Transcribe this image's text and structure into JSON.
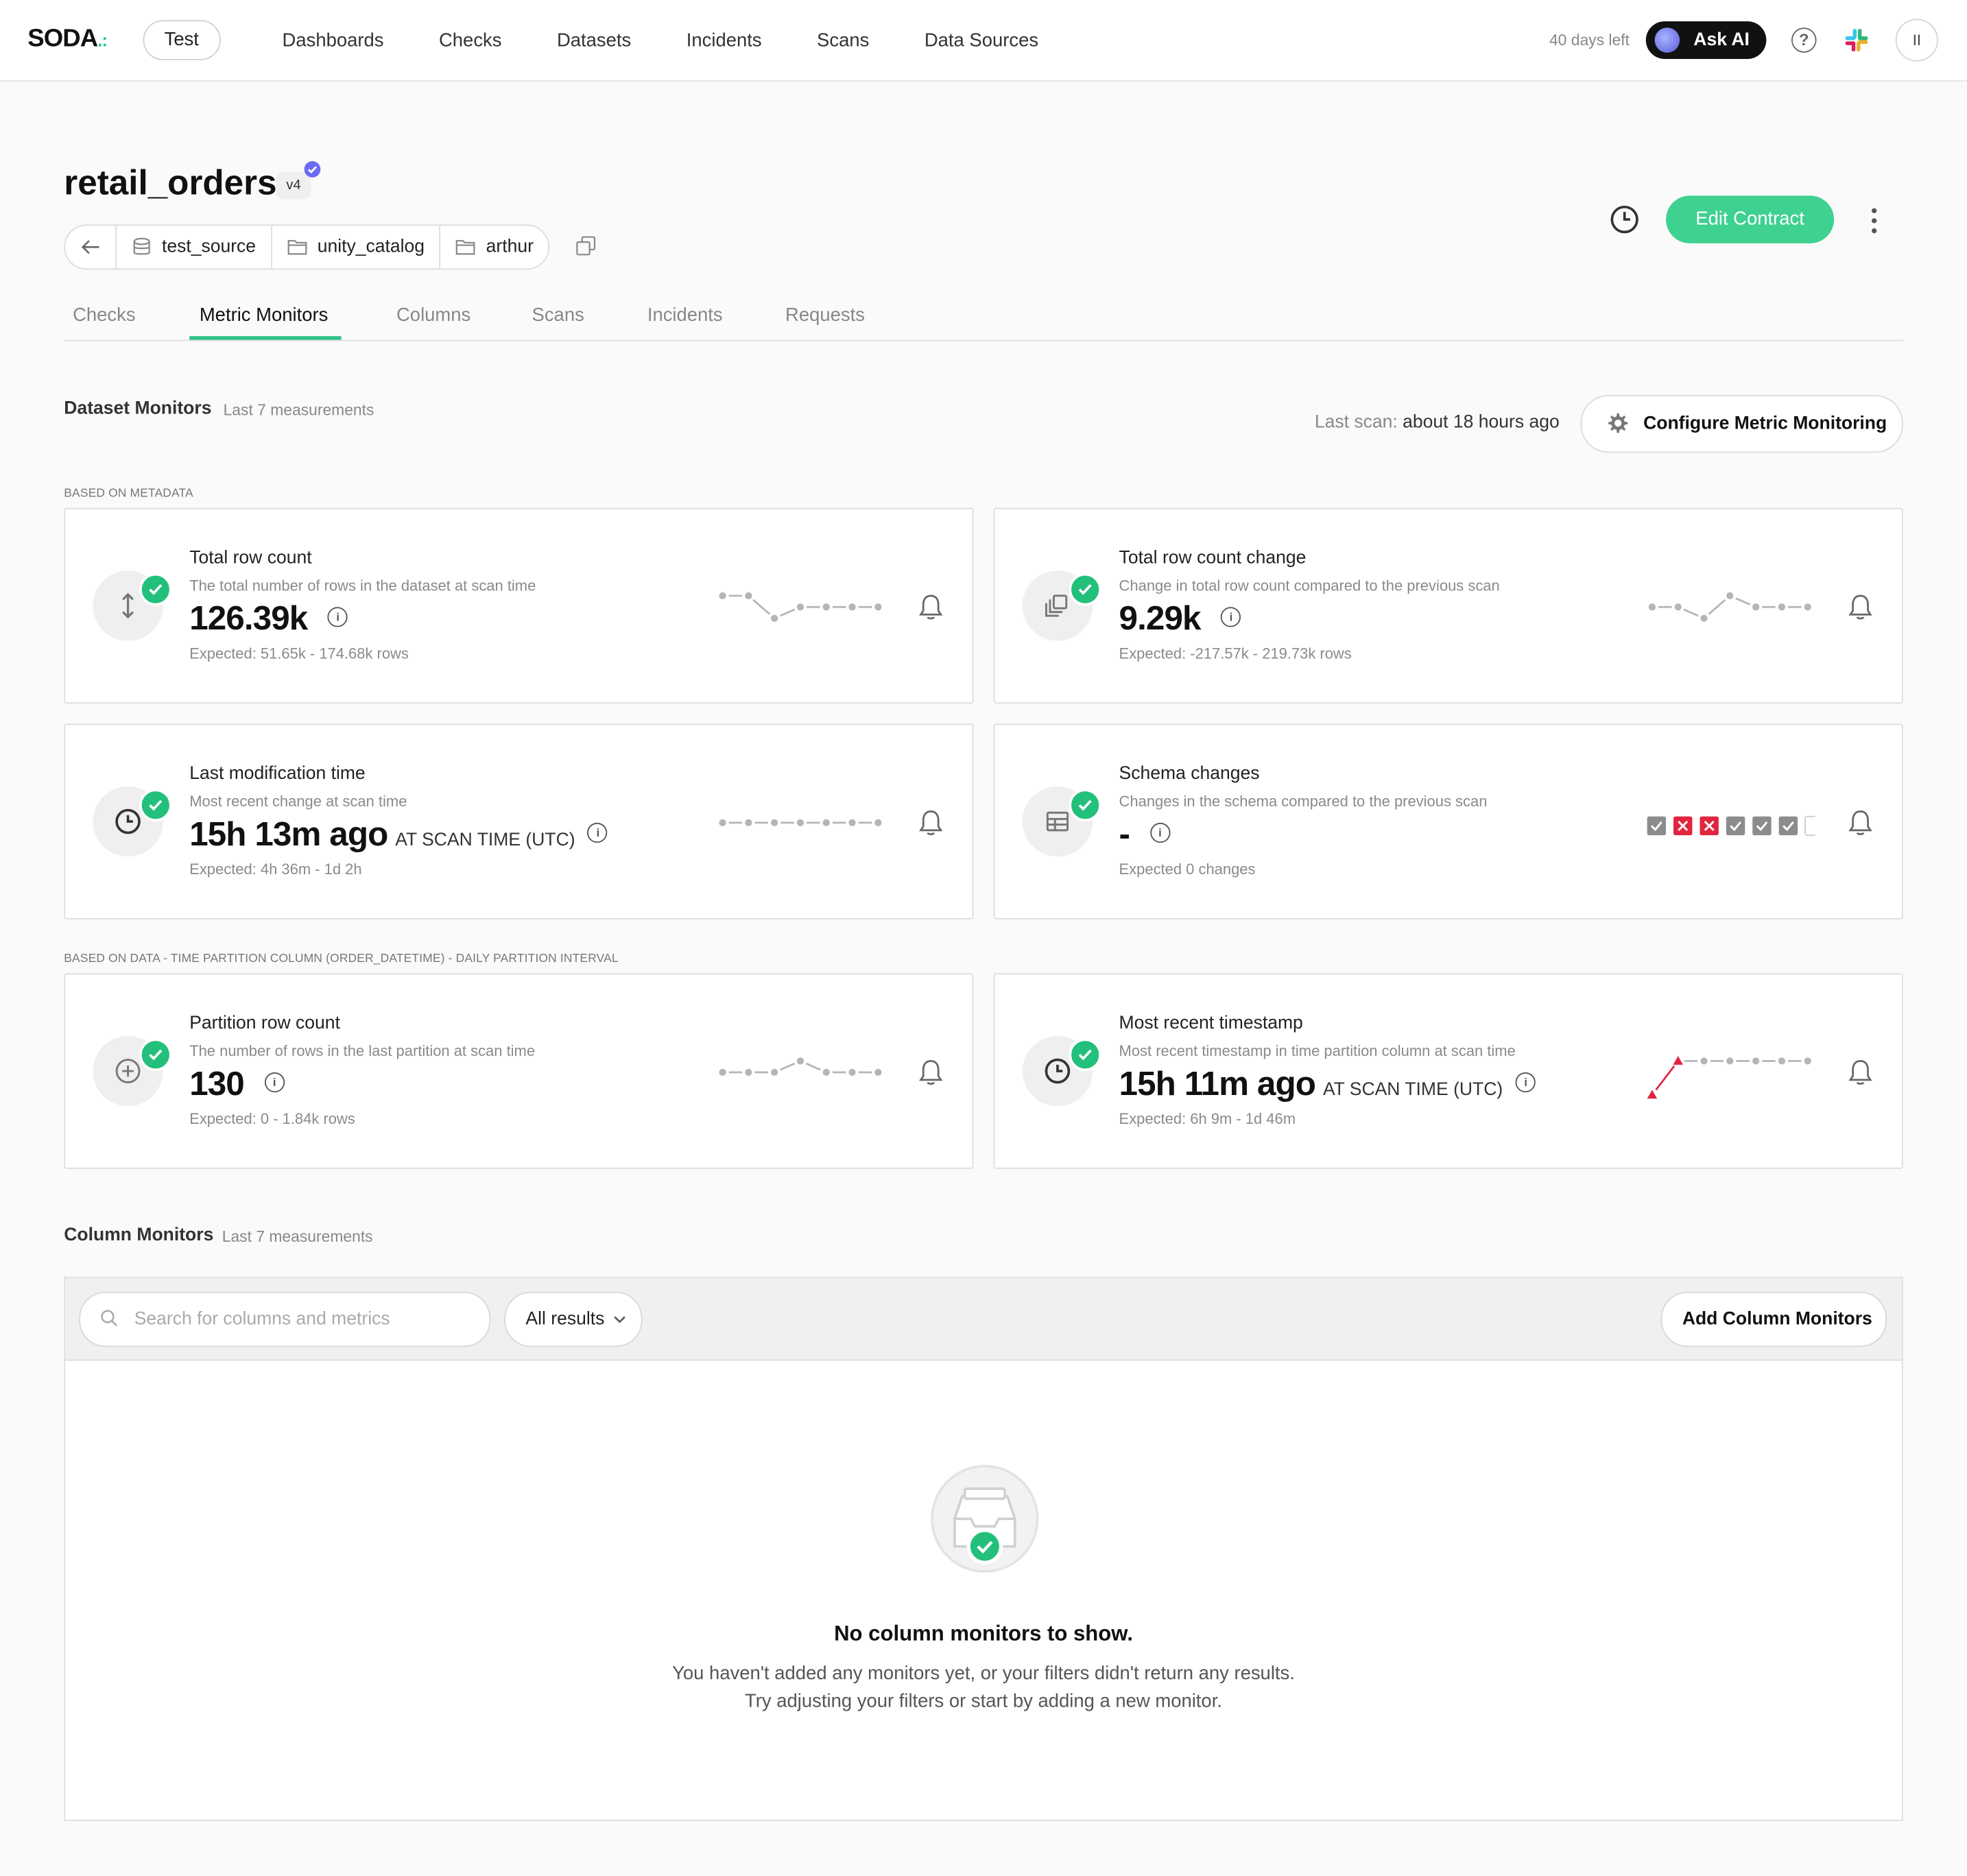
{
  "brand": {
    "name": "SODA",
    "accent": "#23c48e"
  },
  "topbar": {
    "org": "Test",
    "nav": [
      "Dashboards",
      "Checks",
      "Datasets",
      "Incidents",
      "Scans",
      "Data Sources"
    ],
    "days_left": "40 days left",
    "ask_ai": "Ask AI",
    "help": "?",
    "user_initials": "II"
  },
  "dataset": {
    "name": "retail_orders",
    "version": "v4",
    "breadcrumbs": [
      "test_source",
      "unity_catalog",
      "arthur"
    ],
    "edit_contract": "Edit Contract"
  },
  "tabs": [
    "Checks",
    "Metric Monitors",
    "Columns",
    "Scans",
    "Incidents",
    "Requests"
  ],
  "active_tab": "Metric Monitors",
  "dataset_monitors": {
    "title": "Dataset Monitors",
    "subtitle": "Last 7 measurements",
    "last_scan_label": "Last scan:",
    "last_scan_value": "about 18 hours ago",
    "configure": "Configure Metric Monitoring",
    "group_metadata": "BASED ON METADATA",
    "group_data": "BASED ON DATA - TIME PARTITION COLUMN (ORDER_DATETIME) - DAILY PARTITION INTERVAL"
  },
  "cards": [
    {
      "title": "Total row count",
      "desc": "The total number of rows in the dataset at scan time",
      "value": "126.39k",
      "unit": "",
      "expected": "Expected: 51.65k - 174.68k rows",
      "icon": "arrows-vertical-icon",
      "spark": [
        3,
        3,
        1,
        2,
        2,
        2,
        2
      ]
    },
    {
      "title": "Total row count change",
      "desc": "Change in total row count compared to the previous scan",
      "value": "9.29k",
      "unit": "",
      "expected": "Expected: -217.57k - 219.73k rows",
      "icon": "stacked-copies-icon",
      "spark": [
        2,
        2,
        1,
        3,
        2,
        2,
        2
      ]
    },
    {
      "title": "Last modification time",
      "desc": "Most recent change at scan time",
      "value": "15h 13m ago",
      "unit": "AT SCAN TIME (UTC)",
      "expected": "Expected: 4h 36m - 1d 2h",
      "icon": "clock-icon",
      "spark": [
        2,
        2,
        2,
        2,
        2,
        2,
        2
      ]
    },
    {
      "title": "Schema changes",
      "desc": "Changes in the schema compared to the previous scan",
      "value": "-",
      "unit": "",
      "expected": "Expected 0 changes",
      "icon": "table-icon",
      "schema": [
        "ok",
        "fail",
        "fail",
        "ok",
        "ok",
        "ok",
        "empty"
      ]
    },
    {
      "title": "Partition row count",
      "desc": "The number of rows in the last partition at scan time",
      "value": "130",
      "unit": "",
      "expected": "Expected: 0 - 1.84k rows",
      "icon": "plus-circle-icon",
      "spark": [
        2,
        2,
        2,
        3,
        2,
        2,
        2
      ]
    },
    {
      "title": "Most recent timestamp",
      "desc": "Most recent timestamp in time partition column at scan time",
      "value": "15h 11m ago",
      "unit": "AT SCAN TIME (UTC)",
      "expected": "Expected: 6h 9m - 1d 46m",
      "icon": "clock-icon",
      "spark": [
        0,
        3,
        3,
        3,
        3,
        3,
        3
      ],
      "anomaly": [
        0,
        1
      ]
    }
  ],
  "colors": {
    "ok": "#22c07a",
    "fail": "#e0253f",
    "grey_check": "#8c8c8c",
    "spark": "#b5b5b5"
  },
  "column_monitors": {
    "title": "Column Monitors",
    "subtitle": "Last 7 measurements",
    "search_placeholder": "Search for columns and metrics",
    "filter": "All results",
    "add": "Add Column Monitors",
    "empty_title": "No column monitors to show.",
    "empty_line1": "You haven't added any monitors yet, or your filters didn't return any results.",
    "empty_line2": "Try adjusting your filters or start by adding a new monitor."
  }
}
